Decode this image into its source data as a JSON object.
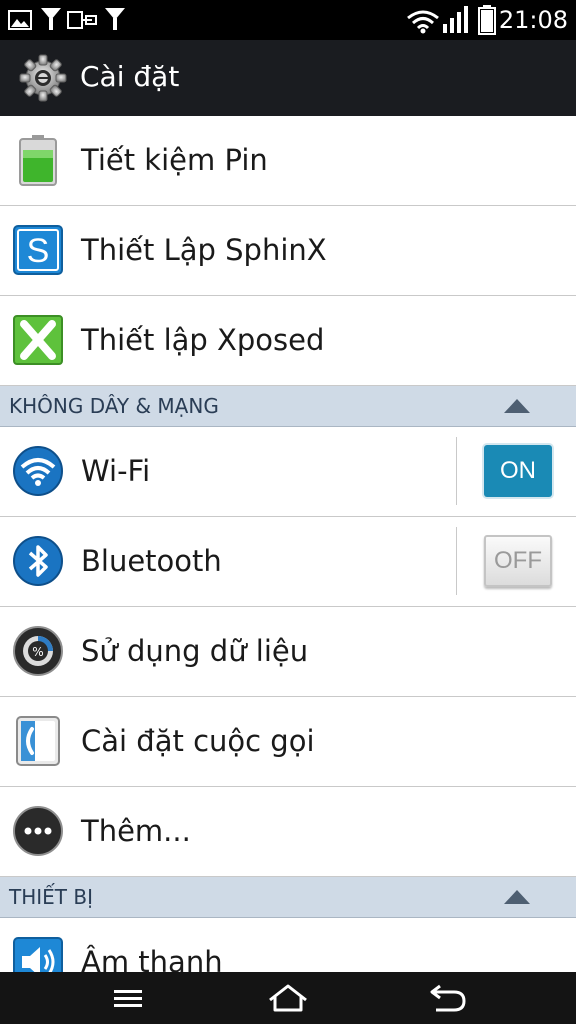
{
  "status_bar": {
    "time": "21:08",
    "icons": [
      "image-icon",
      "download-icon",
      "usb-icon",
      "download-icon",
      "wifi-icon",
      "signal-icon",
      "battery-icon"
    ]
  },
  "action_bar": {
    "title": "Cài đặt",
    "icon": "gear-icon"
  },
  "settings": {
    "top_items": [
      {
        "label": "Tiết kiệm Pin",
        "icon": "battery-saver-icon"
      },
      {
        "label": "Thiết Lập SphinX",
        "icon": "sphinx-icon"
      },
      {
        "label": "Thiết lập Xposed",
        "icon": "xposed-icon"
      }
    ],
    "wireless_section": {
      "header": "KHÔNG DÂY & MẠNG",
      "items": [
        {
          "label": "Wi-Fi",
          "icon": "wifi-icon",
          "toggle": "ON"
        },
        {
          "label": "Bluetooth",
          "icon": "bluetooth-icon",
          "toggle": "OFF"
        },
        {
          "label": "Sử dụng dữ liệu",
          "icon": "data-usage-icon"
        },
        {
          "label": "Cài đặt cuộc gọi",
          "icon": "call-settings-icon"
        },
        {
          "label": "Thêm...",
          "icon": "more-icon"
        }
      ]
    },
    "device_section": {
      "header": "THIẾT BỊ",
      "items": [
        {
          "label": "Âm thanh",
          "icon": "sound-icon"
        }
      ]
    }
  },
  "nav_bar": {
    "buttons": [
      "menu-icon",
      "home-icon",
      "back-icon"
    ]
  },
  "colors": {
    "section_header_bg": "#cfdae6",
    "toggle_on": "#1a8ab5",
    "action_bar_bg": "#1a1c20"
  }
}
